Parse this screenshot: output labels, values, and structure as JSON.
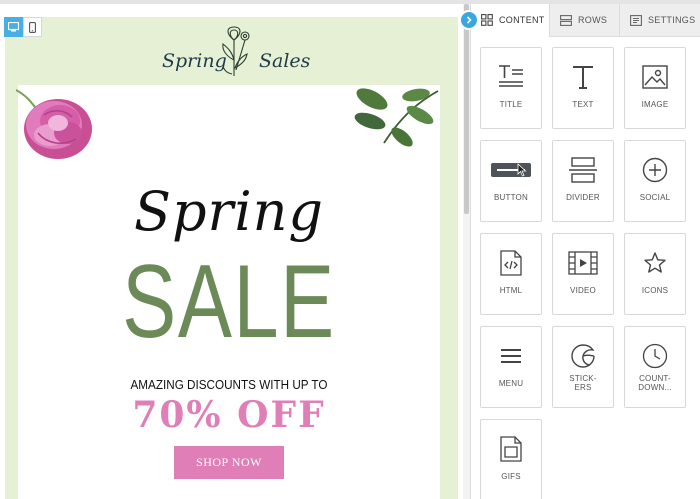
{
  "preview": {
    "device_toggle": {
      "desktop": "desktop-icon",
      "mobile": "mobile-icon"
    },
    "email": {
      "brand_left": "Spring",
      "brand_right": "Sales",
      "headline_script": "Spring",
      "headline_big": "SALE",
      "discount_line": "AMAZING DISCOUNTS WITH UP TO",
      "percent_off": "70% OFF",
      "cta": "SHOP NOW"
    },
    "colors": {
      "frame_bg": "#e6f0d5",
      "sale_green": "#6b8a58",
      "pink": "#e07fb7",
      "brand_blue": "#1f3b4a"
    }
  },
  "panel": {
    "tabs": [
      {
        "label": "CONTENT",
        "icon": "grid-icon",
        "active": true
      },
      {
        "label": "ROWS",
        "icon": "rows-icon",
        "active": false
      },
      {
        "label": "SETTINGS",
        "icon": "settings-icon",
        "active": false
      }
    ],
    "tiles": [
      {
        "label": "TITLE",
        "icon": "title-icon"
      },
      {
        "label": "TEXT",
        "icon": "text-icon"
      },
      {
        "label": "IMAGE",
        "icon": "image-icon"
      },
      {
        "label": "BUTTON",
        "icon": "button-icon"
      },
      {
        "label": "DIVIDER",
        "icon": "divider-icon"
      },
      {
        "label": "SOCIAL",
        "icon": "social-icon"
      },
      {
        "label": "HTML",
        "icon": "html-icon"
      },
      {
        "label": "VIDEO",
        "icon": "video-icon"
      },
      {
        "label": "ICONS",
        "icon": "star-icon"
      },
      {
        "label": "MENU",
        "icon": "menu-icon"
      },
      {
        "label": "STICK-\nERS",
        "icon": "sticker-icon"
      },
      {
        "label": "COUNT-\nDOWN...",
        "icon": "clock-icon"
      },
      {
        "label": "GIFS",
        "icon": "gif-icon"
      }
    ],
    "accent": "#3aa8df"
  }
}
